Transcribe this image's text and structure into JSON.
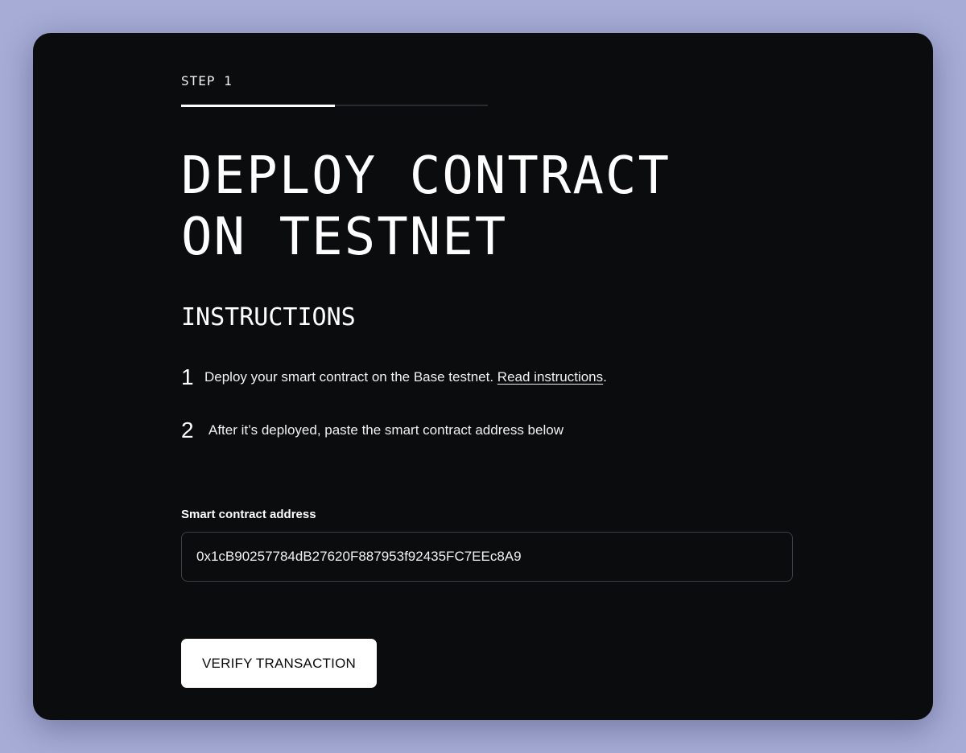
{
  "step": {
    "label": "STEP 1",
    "progress_fraction": 0.5
  },
  "title": "DEPLOY CONTRACT\nON TESTNET",
  "instructions": {
    "heading": "INSTRUCTIONS",
    "items": [
      {
        "number": "1",
        "text": "Deploy your smart contract on the Base testnet. ",
        "link_text": "Read instructions",
        "suffix": "."
      },
      {
        "number": "2",
        "text": "After it’s deployed, paste the smart contract address below"
      }
    ]
  },
  "form": {
    "address_label": "Smart contract address",
    "address_value": "0x1cB90257784dB27620F887953f92435FC7EEc8A9",
    "submit_label": "VERIFY TRANSACTION"
  },
  "colors": {
    "background": "#a6acd6",
    "card": "#0b0c0e",
    "text": "#ffffff",
    "button_bg": "#ffffff",
    "button_text": "#0b0c0e"
  }
}
